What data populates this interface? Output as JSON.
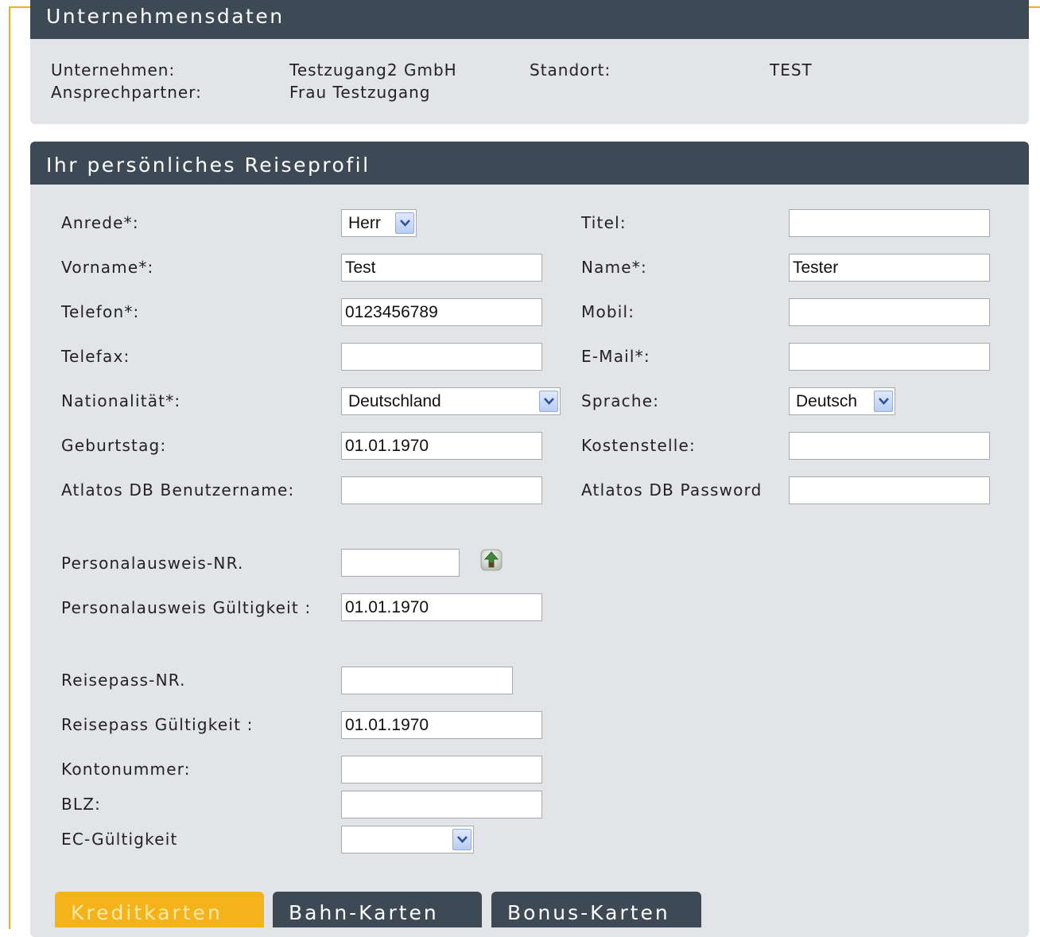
{
  "company_section": {
    "title": "Unternehmensdaten",
    "company_label": "Unternehmen:",
    "company_value": "Testzugang2  GmbH",
    "contact_label": "Ansprechpartner:",
    "contact_value": "Frau Testzugang",
    "location_label": "Standort:",
    "location_value": "TEST"
  },
  "profile_section": {
    "title": "Ihr persönliches Reiseprofil",
    "anrede": {
      "label": "Anrede*:",
      "value": "Herr"
    },
    "titel": {
      "label": "Titel:",
      "value": ""
    },
    "vorname": {
      "label": "Vorname*:",
      "value": "Test"
    },
    "name": {
      "label": "Name*:",
      "value": "Tester"
    },
    "telefon": {
      "label": "Telefon*:",
      "value": "0123456789"
    },
    "mobil": {
      "label": "Mobil:",
      "value": ""
    },
    "telefax": {
      "label": "Telefax:",
      "value": ""
    },
    "email": {
      "label": "E-Mail*:",
      "value": ""
    },
    "nationalitaet": {
      "label": "Nationalität*:",
      "value": "Deutschland"
    },
    "sprache": {
      "label": "Sprache:",
      "value": "Deutsch"
    },
    "geburtstag": {
      "label": "Geburtstag:",
      "value": "01.01.1970"
    },
    "kostenstelle": {
      "label": "Kostenstelle:",
      "value": ""
    },
    "db_user": {
      "label": "Atlatos DB Benutzername:",
      "value": ""
    },
    "db_password": {
      "label": "Atlatos DB Password",
      "value": ""
    },
    "personalausweis_nr": {
      "label": "Personalausweis-NR.",
      "value": ""
    },
    "personalausweis_gueltig": {
      "label": "Personalausweis Gültigkeit :",
      "value": "01.01.1970"
    },
    "reisepass_nr": {
      "label": "Reisepass-NR.",
      "value": ""
    },
    "reisepass_gueltig": {
      "label": "Reisepass Gültigkeit :",
      "value": "01.01.1970"
    },
    "kontonummer": {
      "label": "Kontonummer:",
      "value": ""
    },
    "blz": {
      "label": "BLZ:",
      "value": ""
    },
    "ec_gueltig": {
      "label": "EC-Gültigkeit",
      "value": ""
    }
  },
  "tabs": [
    {
      "label": "Kreditkarten"
    },
    {
      "label": "Bahn-Karten"
    },
    {
      "label": "Bonus-Karten"
    }
  ],
  "colors": {
    "header_bg": "#3d4a55",
    "panel_bg": "#e2e4e8",
    "accent": "#f5b31b"
  },
  "icons": {
    "upload": "upload-arrow-icon",
    "dropdown": "chevron-down-icon"
  }
}
